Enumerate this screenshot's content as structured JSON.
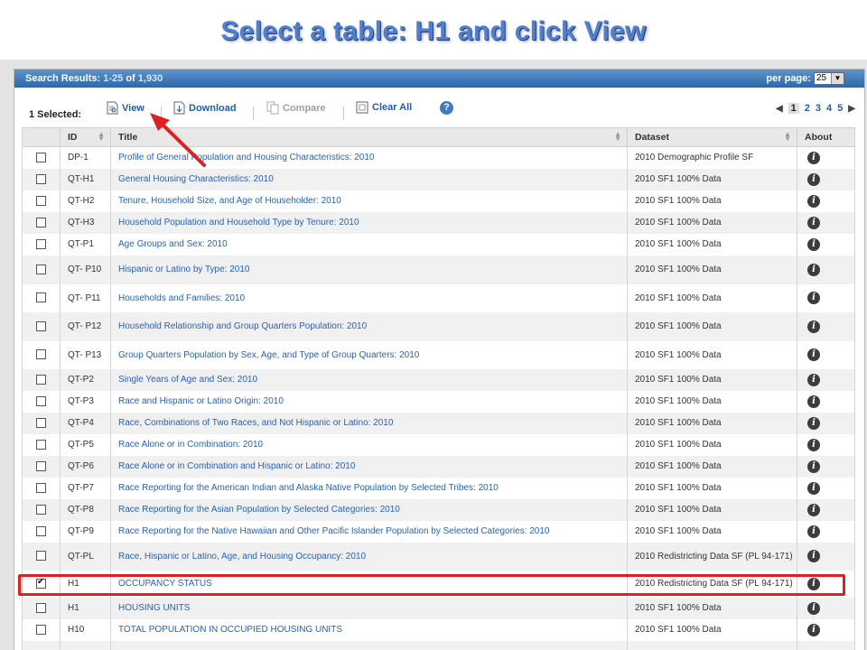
{
  "slide": {
    "title": "Select a table:  H1 and click View"
  },
  "results": {
    "label": "Search Results:",
    "range": "1-25",
    "of": "of",
    "total": "1,930",
    "per_page_label": "per page:",
    "per_page_value": "25"
  },
  "toolbar": {
    "selected": "1 Selected:",
    "view": "View",
    "download": "Download",
    "compare": "Compare",
    "clear_all": "Clear All",
    "help": "?"
  },
  "pager": {
    "pages": [
      "1",
      "2",
      "3",
      "4",
      "5"
    ],
    "current": "1"
  },
  "table": {
    "columns": {
      "id": "ID",
      "title": "Title",
      "dataset": "Dataset",
      "about": "About"
    },
    "rows": [
      {
        "id": "DP-1",
        "title": "Profile of General Population and Housing Characteristics: 2010",
        "dataset": "2010 Demographic Profile SF",
        "checked": false
      },
      {
        "id": "QT-H1",
        "title": "General Housing Characteristics: 2010",
        "dataset": "2010 SF1 100% Data",
        "checked": false
      },
      {
        "id": "QT-H2",
        "title": "Tenure, Household Size, and Age of Householder: 2010",
        "dataset": "2010 SF1 100% Data",
        "checked": false
      },
      {
        "id": "QT-H3",
        "title": "Household Population and Household Type by Tenure: 2010",
        "dataset": "2010 SF1 100% Data",
        "checked": false
      },
      {
        "id": "QT-P1",
        "title": "Age Groups and Sex: 2010",
        "dataset": "2010 SF1 100% Data",
        "checked": false
      },
      {
        "id": "QT- P10",
        "title": "Hispanic or Latino by Type: 2010",
        "dataset": "2010 SF1 100% Data",
        "checked": false
      },
      {
        "id": "QT- P11",
        "title": "Households and Families: 2010",
        "dataset": "2010 SF1 100% Data",
        "checked": false
      },
      {
        "id": "QT- P12",
        "title": "Household Relationship and Group Quarters Population: 2010",
        "dataset": "2010 SF1 100% Data",
        "checked": false
      },
      {
        "id": "QT- P13",
        "title": "Group Quarters Population by Sex, Age, and Type of Group Quarters: 2010",
        "dataset": "2010 SF1 100% Data",
        "checked": false
      },
      {
        "id": "QT-P2",
        "title": "Single Years of Age and Sex: 2010",
        "dataset": "2010 SF1 100% Data",
        "checked": false
      },
      {
        "id": "QT-P3",
        "title": "Race and Hispanic or Latino Origin: 2010",
        "dataset": "2010 SF1 100% Data",
        "checked": false
      },
      {
        "id": "QT-P4",
        "title": "Race, Combinations of Two Races, and Not Hispanic or Latino: 2010",
        "dataset": "2010 SF1 100% Data",
        "checked": false
      },
      {
        "id": "QT-P5",
        "title": "Race Alone or in Combination: 2010",
        "dataset": "2010 SF1 100% Data",
        "checked": false
      },
      {
        "id": "QT-P6",
        "title": "Race Alone or in Combination and Hispanic or Latino: 2010",
        "dataset": "2010 SF1 100% Data",
        "checked": false
      },
      {
        "id": "QT-P7",
        "title": "Race Reporting for the American Indian and Alaska Native Population by Selected Tribes: 2010",
        "dataset": "2010 SF1 100% Data",
        "checked": false
      },
      {
        "id": "QT-P8",
        "title": "Race Reporting for the Asian Population by Selected Categories: 2010",
        "dataset": "2010 SF1 100% Data",
        "checked": false
      },
      {
        "id": "QT-P9",
        "title": "Race Reporting for the Native Hawaiian and Other Pacific Islander Population by Selected Categories: 2010",
        "dataset": "2010 SF1 100% Data",
        "checked": false
      },
      {
        "id": "QT-PL",
        "title": "Race, Hispanic or Latino, Age, and Housing Occupancy: 2010",
        "dataset": "2010 Redistricting Data SF (PL 94-171)",
        "checked": false
      },
      {
        "id": "H1",
        "title": "OCCUPANCY STATUS",
        "dataset": "2010 Redistricting Data SF (PL 94-171)",
        "checked": true
      },
      {
        "id": "H1",
        "title": "HOUSING UNITS",
        "dataset": "2010 SF1 100% Data",
        "checked": false
      },
      {
        "id": "H10",
        "title": "TOTAL POPULATION IN OCCUPIED HOUSING UNITS",
        "dataset": "2010 SF1 100% Data",
        "checked": false
      },
      {
        "id": "",
        "title": "",
        "dataset": "",
        "checked": false
      }
    ]
  },
  "colors": {
    "title_blue": "#4f7fd1",
    "link_blue": "#2a63b0",
    "highlight_red": "#e02020",
    "header_bar": "#2f68a8"
  },
  "icons": {
    "info": "i",
    "view": "view-document-icon",
    "download": "download-icon",
    "compare": "compare-icon",
    "clear_all": "clear-all-icon"
  }
}
